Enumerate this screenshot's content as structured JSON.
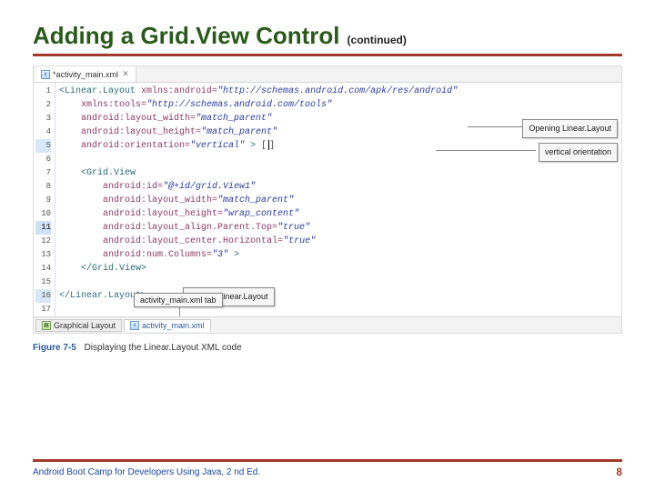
{
  "slide": {
    "title": "Adding a Grid.View Control",
    "subtitle": "(continued)"
  },
  "tabbar": {
    "filename": "*activity_main.xml"
  },
  "gutter": {
    "lines": 17
  },
  "code": {
    "l1": {
      "tag": "<Linear.Layout",
      "attr": "xmlns:android=",
      "val": "\"http://schemas.android.com/apk/res/android\""
    },
    "l2": {
      "attr": "xmlns:tools=",
      "val": "\"http://schemas.android.com/tools\""
    },
    "l3": {
      "attr": "android:layout_width=",
      "val": "\"match_parent\""
    },
    "l4": {
      "attr": "android:layout_height=",
      "val": "\"match_parent\""
    },
    "l5": {
      "attr": "android:orientation=",
      "val": "\"vertical\"",
      "close": " >"
    },
    "l7": {
      "tag": "<Grid.View"
    },
    "l8": {
      "attr": "android:id=",
      "val": "\"@+id/grid.View1\""
    },
    "l9": {
      "attr": "android:layout_width=",
      "val": "\"match_parent\""
    },
    "l10": {
      "attr": "android:layout_height=",
      "val": "\"wrap_content\""
    },
    "l11": {
      "attr": "android:layout_align.Parent.Top=",
      "val": "\"true\""
    },
    "l12": {
      "attr": "android:layout_center.Horizontal=",
      "val": "\"true\""
    },
    "l13": {
      "attr": "android:num.Columns=",
      "val": "\"3\"",
      "close": " >"
    },
    "l14": {
      "tag": "</Grid.View>"
    },
    "l16": {
      "tag": "</Linear.Layout>"
    }
  },
  "callouts": {
    "opening": "Opening Linear.Layout",
    "vertical": "vertical orientation",
    "closing": "Closing Linear.Layout",
    "activity_tab": "activity_main.xml tab"
  },
  "bottom_tabs": {
    "graphical": "Graphical Layout",
    "xml": "activity_main.xml"
  },
  "figure": {
    "num": "Figure 7-5",
    "caption": "Displaying the Linear.Layout XML code"
  },
  "footer": {
    "book": "Android Boot Camp for Developers Using Java, 2 nd Ed.",
    "page": "8"
  }
}
